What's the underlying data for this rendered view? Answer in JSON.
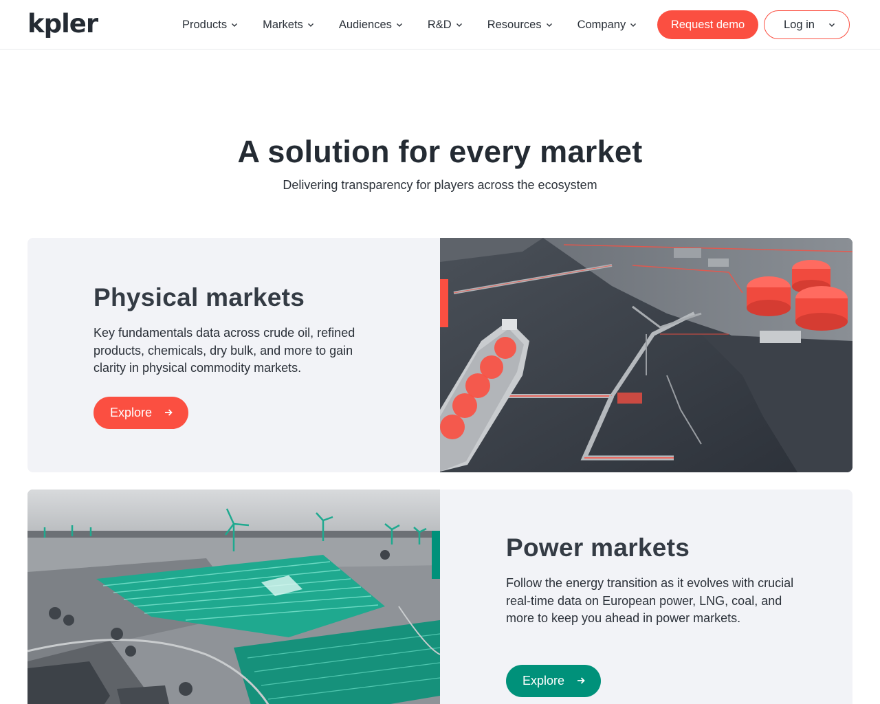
{
  "header": {
    "logo": "kpler",
    "nav": [
      {
        "label": "Products"
      },
      {
        "label": "Markets"
      },
      {
        "label": "Audiences"
      },
      {
        "label": "R&D"
      },
      {
        "label": "Resources"
      },
      {
        "label": "Company"
      }
    ],
    "request_demo": "Request demo",
    "login": "Log in"
  },
  "hero": {
    "title": "A solution for every market",
    "subtitle": "Delivering transparency for players across the ecosystem"
  },
  "cards": [
    {
      "title": "Physical markets",
      "description": "Key fundamentals data across crude oil, refined products, chemicals, dry bulk, and more to gain clarity in physical commodity markets.",
      "button": "Explore",
      "accent": "#fb4f41"
    },
    {
      "title": "Power markets",
      "description": "Follow the energy transition as it evolves with crucial real-time data on European power, LNG, coal, and more to keep you ahead in power markets.",
      "button": "Explore",
      "accent": "#00917a"
    }
  ],
  "icons": {
    "chevron": "chevron-down-icon",
    "arrow": "arrow-right-icon"
  },
  "colors": {
    "brand_red": "#fb4f41",
    "brand_green": "#00917a",
    "card_bg": "#f2f3f7",
    "text_dark": "#242b33"
  }
}
